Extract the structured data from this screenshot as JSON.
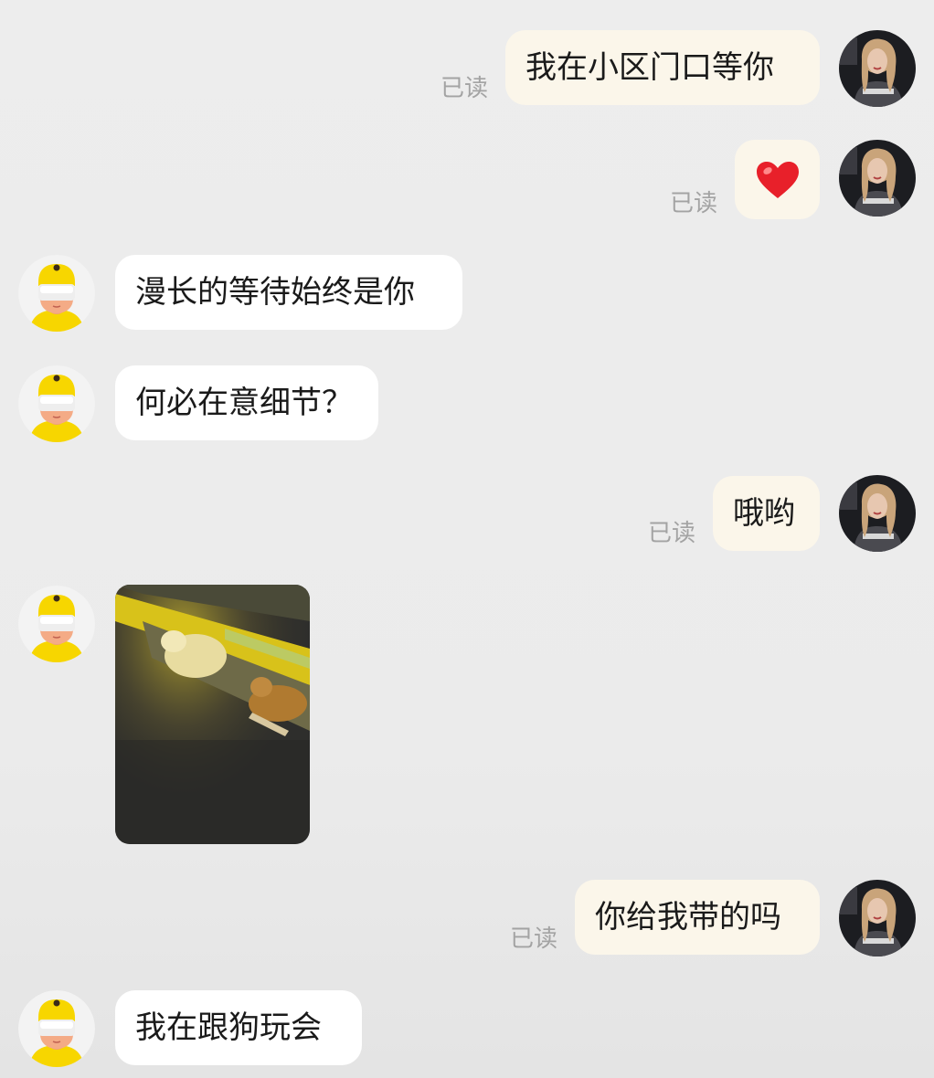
{
  "chat": {
    "read_label": "已读",
    "messages": [
      {
        "sender": "me",
        "text": "我在小区门口等你"
      },
      {
        "sender": "me",
        "icon": "red-heart-emoji"
      },
      {
        "sender": "other",
        "text": "漫长的等待始终是你"
      },
      {
        "sender": "other",
        "text": "何必在意细节？"
      },
      {
        "sender": "me",
        "text": "哦哟"
      },
      {
        "sender": "other",
        "image": "photo of two dogs lying under a step in yellow light"
      },
      {
        "sender": "me",
        "text": "你给我带的吗"
      },
      {
        "sender": "other",
        "text": "我在跟狗玩会"
      }
    ]
  },
  "colors": {
    "background": "#ededed",
    "my_bubble": "#fbf6ea",
    "their_bubble": "#ffffff",
    "read_text": "#a3a3a3",
    "heart": "#e8202a",
    "avatar_yellow": "#f7d600"
  }
}
